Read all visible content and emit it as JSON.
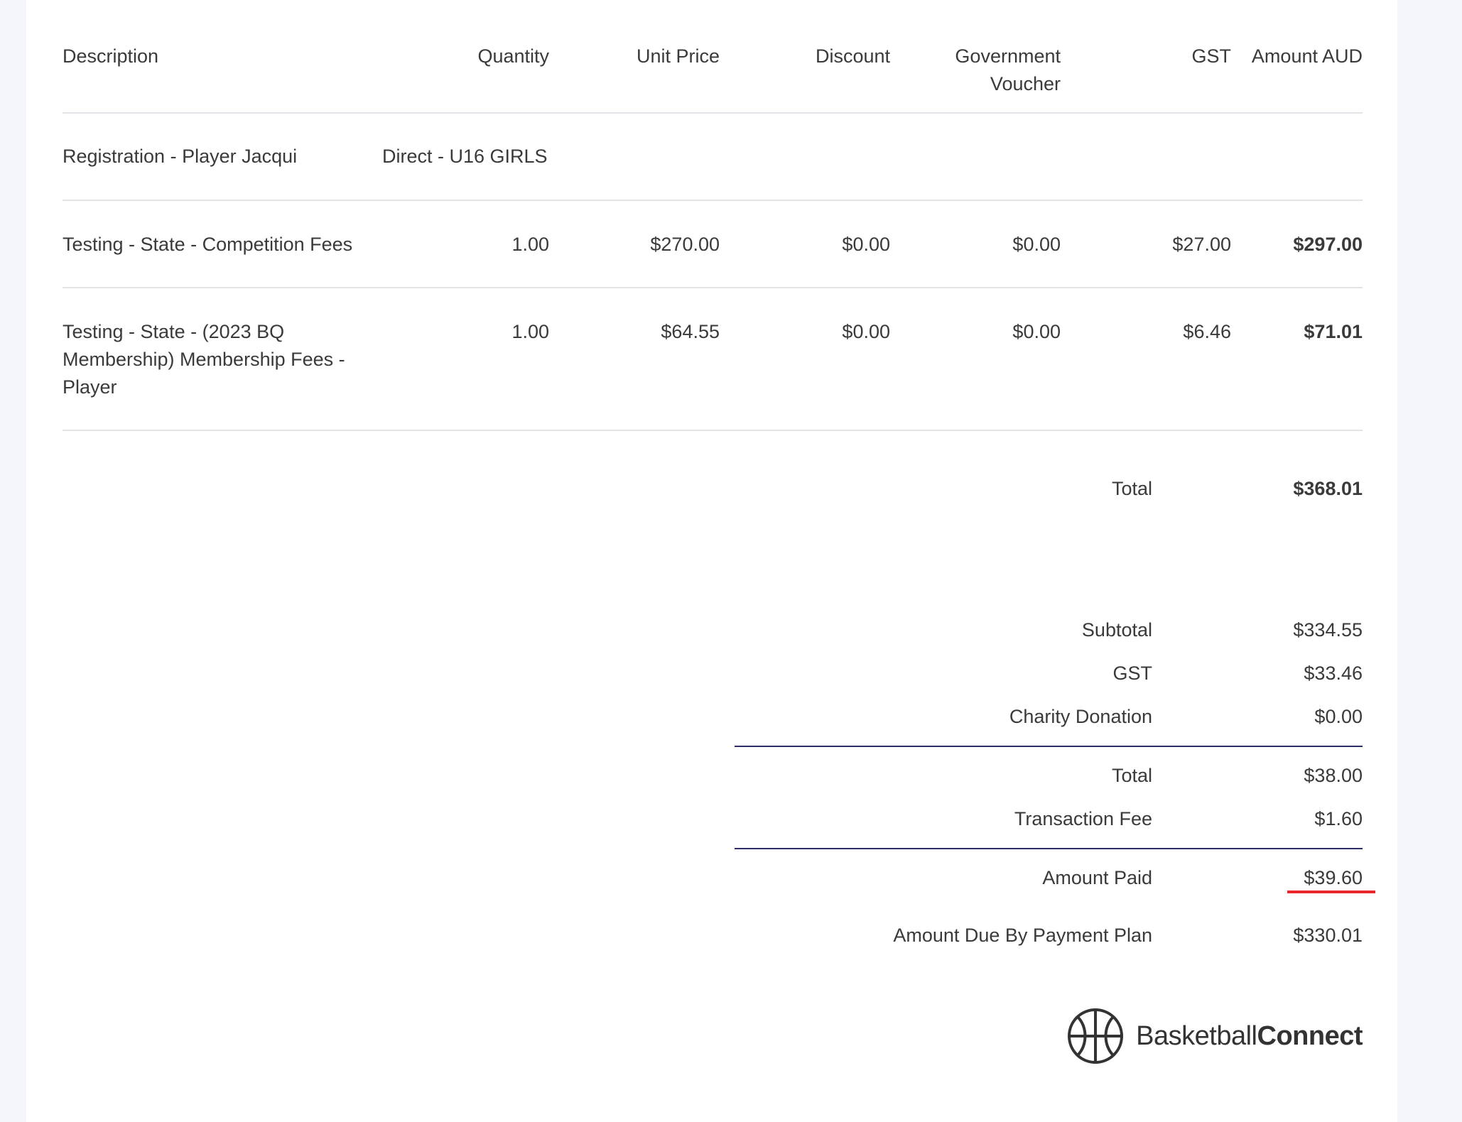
{
  "table": {
    "headers": {
      "description": "Description",
      "quantity": "Quantity",
      "unit_price": "Unit Price",
      "discount": "Discount",
      "government_voucher_line1": "Government",
      "government_voucher_line2": "Voucher",
      "gst": "GST",
      "amount": "Amount AUD"
    },
    "group": {
      "name": "Registration - Player Jacqui",
      "division": "Direct - U16 GIRLS"
    },
    "rows": [
      {
        "description": "Testing - State - Competition Fees",
        "quantity": "1.00",
        "unit_price": "$270.00",
        "discount": "$0.00",
        "government_voucher": "$0.00",
        "gst": "$27.00",
        "amount": "$297.00"
      },
      {
        "description": "Testing - State - (2023 BQ Membership) Membership Fees - Player",
        "quantity": "1.00",
        "unit_price": "$64.55",
        "discount": "$0.00",
        "government_voucher": "$0.00",
        "gst": "$6.46",
        "amount": "$71.01"
      }
    ],
    "total_label": "Total",
    "total_value": "$368.01"
  },
  "summary": {
    "subtotal_label": "Subtotal",
    "subtotal_value": "$334.55",
    "gst_label": "GST",
    "gst_value": "$33.46",
    "charity_label": "Charity Donation",
    "charity_value": "$0.00",
    "total_label": "Total",
    "total_value": "$38.00",
    "transaction_fee_label": "Transaction Fee",
    "transaction_fee_value": "$1.60",
    "amount_paid_label": "Amount Paid",
    "amount_paid_value": "$39.60",
    "amount_due_label": "Amount Due By Payment Plan",
    "amount_due_value": "$330.01"
  },
  "logo": {
    "text_light": "Basketball",
    "text_bold": "Connect",
    "icon": "basketball-icon"
  },
  "colors": {
    "separator": "#2d2e6a",
    "highlight_underline": "#e8262b"
  }
}
